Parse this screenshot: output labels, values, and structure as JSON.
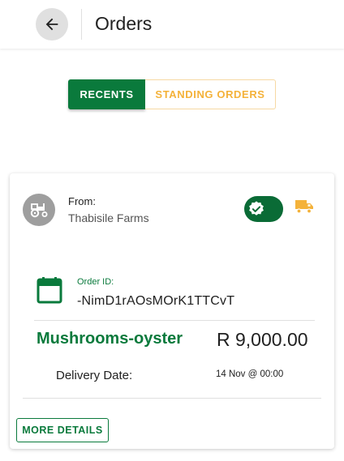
{
  "header": {
    "title": "Orders",
    "back_icon": "arrow-left-icon"
  },
  "tabs": [
    {
      "label": "RECENTS",
      "active": true
    },
    {
      "label": "STANDING ORDERS",
      "active": false
    }
  ],
  "order": {
    "from_label": "From:",
    "from_name": "Thabisile Farms",
    "avatar_icon": "tractor-icon",
    "status_icon": "verified-badge-icon",
    "delivery_icon": "truck-icon",
    "order_id_label": "Order ID:",
    "order_id": "-NimD1rAOsMOrK1TTCvT",
    "product": "Mushrooms-oyster",
    "price": "R 9,000.00",
    "delivery_label": "Delivery Date:",
    "delivery_value": "14 Nov @ 00:00",
    "more_label": "MORE DETAILS"
  },
  "colors": {
    "primary": "#0a7a3c",
    "accent": "#f4b23a",
    "toggle": "#0a6b36"
  }
}
